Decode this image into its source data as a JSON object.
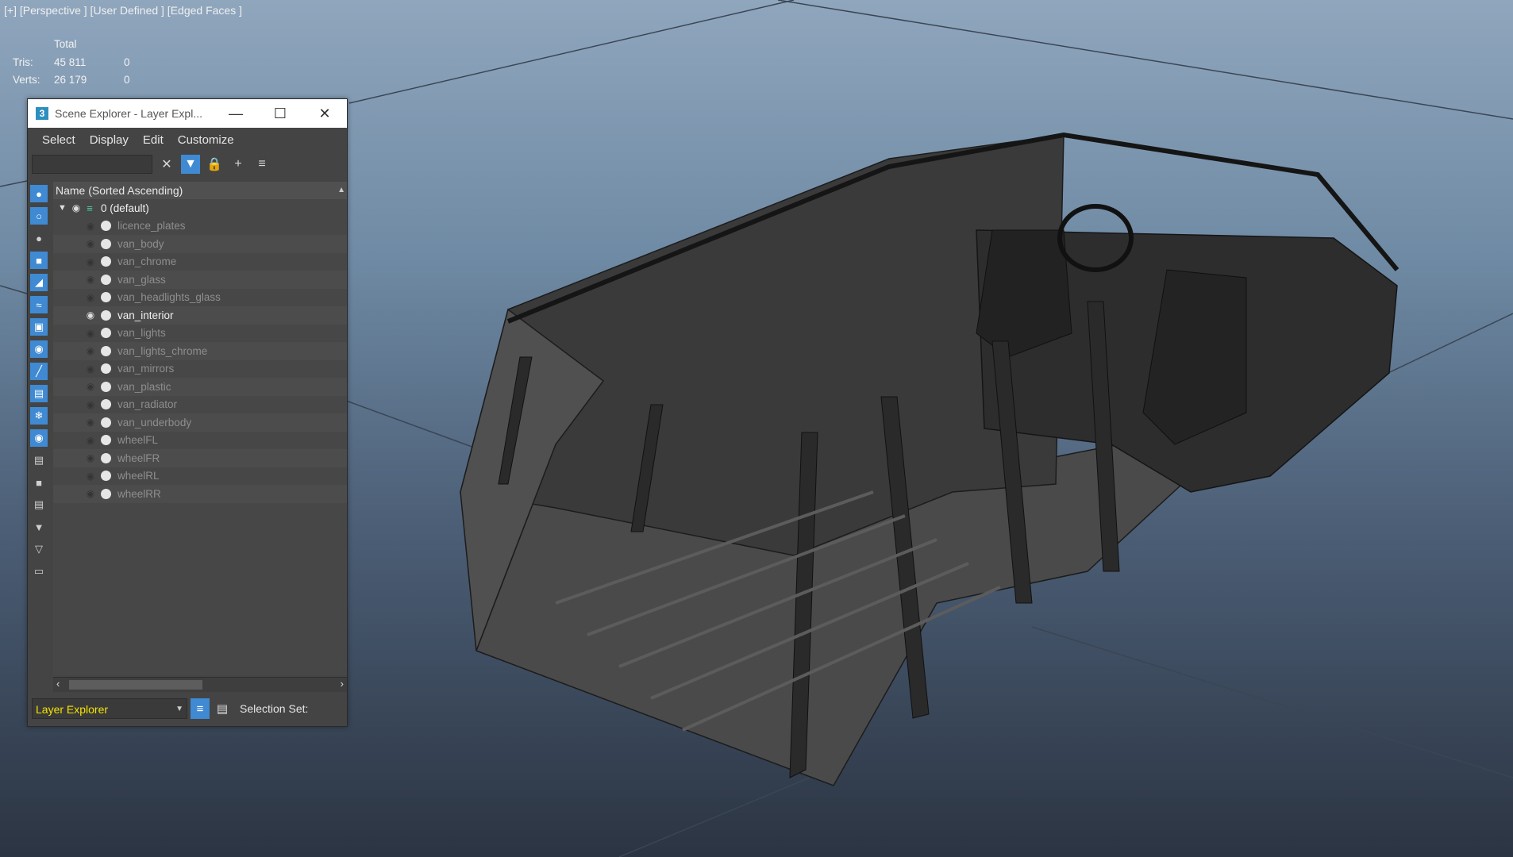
{
  "viewport": {
    "label": "[+] [Perspective ] [User Defined ] [Edged Faces ]",
    "stats": {
      "header": "Total",
      "rows": [
        {
          "label": "Tris:",
          "total": "45 811",
          "selected": "0"
        },
        {
          "label": "Verts:",
          "total": "26 179",
          "selected": "0"
        }
      ]
    }
  },
  "explorer": {
    "title": "Scene Explorer - Layer Expl...",
    "app_icon": "3",
    "menu": [
      "Select",
      "Display",
      "Edit",
      "Customize"
    ],
    "column_header": "Name (Sorted Ascending)",
    "layer": {
      "name": "0 (default)"
    },
    "items": [
      {
        "name": "licence_plates",
        "visible": false
      },
      {
        "name": "van_body",
        "visible": false
      },
      {
        "name": "van_chrome",
        "visible": false
      },
      {
        "name": "van_glass",
        "visible": false
      },
      {
        "name": "van_headlights_glass",
        "visible": false
      },
      {
        "name": "van_interior",
        "visible": true
      },
      {
        "name": "van_lights",
        "visible": false
      },
      {
        "name": "van_lights_chrome",
        "visible": false
      },
      {
        "name": "van_mirrors",
        "visible": false
      },
      {
        "name": "van_plastic",
        "visible": false
      },
      {
        "name": "van_radiator",
        "visible": false
      },
      {
        "name": "van_underbody",
        "visible": false
      },
      {
        "name": "wheelFL",
        "visible": false
      },
      {
        "name": "wheelFR",
        "visible": false
      },
      {
        "name": "wheelRL",
        "visible": false
      },
      {
        "name": "wheelRR",
        "visible": false
      }
    ],
    "explorer_mode": "Layer Explorer",
    "selection_set_label": "Selection Set:"
  },
  "colors": {
    "accent": "#3f8ad2",
    "dropdown_text": "#f5e400"
  }
}
